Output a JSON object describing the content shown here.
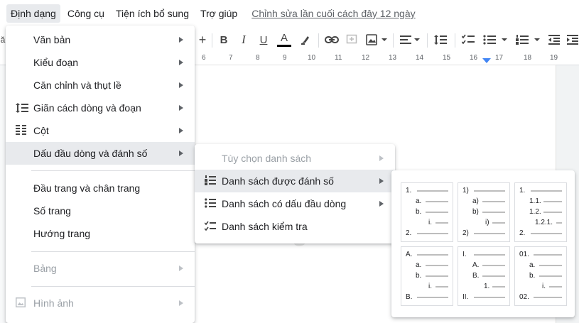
{
  "menubar": {
    "items": [
      "Định dạng",
      "Công cụ",
      "Tiện ích bổ sung",
      "Trợ giúp"
    ],
    "last_edit": "Chỉnh sửa lần cuối cách đây 12 ngày"
  },
  "toolbar": {
    "plus": "+",
    "bold": "B",
    "italic": "I",
    "underline": "U",
    "text_color": "A",
    "text_color_value": "#000000",
    "left_fragment": "ă"
  },
  "ruler": {
    "numbers": [
      "6",
      "7",
      "8",
      "9",
      "10",
      "11",
      "12",
      "13",
      "14",
      "15",
      "16",
      "17",
      "18",
      "19"
    ]
  },
  "format_menu": {
    "items": [
      {
        "label": "Văn bản",
        "submenu": true
      },
      {
        "label": "Kiểu đoạn",
        "submenu": true
      },
      {
        "label": "Căn chỉnh và thụt lề",
        "submenu": true
      },
      {
        "label": "Giãn cách dòng và đoạn",
        "submenu": true,
        "icon": "line-spacing-icon"
      },
      {
        "label": "Cột",
        "submenu": true,
        "icon": "columns-icon"
      },
      {
        "label": "Dấu đầu dòng và đánh số",
        "submenu": true,
        "active": true
      },
      {
        "label": "Đầu trang và chân trang"
      },
      {
        "label": "Số trang"
      },
      {
        "label": "Hướng trang"
      },
      {
        "label": "Bảng",
        "submenu": true,
        "disabled": true
      },
      {
        "label": "Hình ảnh",
        "submenu": true,
        "disabled": true,
        "icon": "image-icon"
      }
    ]
  },
  "bullets_menu": {
    "items": [
      {
        "label": "Tùy chọn danh sách",
        "submenu": true,
        "disabled": true
      },
      {
        "label": "Danh sách được đánh số",
        "submenu": true,
        "active": true
      },
      {
        "label": "Danh sách có dấu đầu dòng",
        "submenu": true
      },
      {
        "label": "Danh sách kiểm tra"
      }
    ]
  },
  "numbered_presets": [
    {
      "markers": [
        "1.",
        "a.",
        "b.",
        "i.",
        "2."
      ]
    },
    {
      "markers": [
        "1)",
        "a)",
        "b)",
        "i)",
        "2)"
      ]
    },
    {
      "markers": [
        "1.",
        "1.1.",
        "1.2.",
        "1.2.1.",
        "2."
      ]
    },
    {
      "markers": [
        "A.",
        "a.",
        "b.",
        "i.",
        "B."
      ]
    },
    {
      "markers": [
        "I.",
        "A.",
        "B.",
        "1.",
        "II."
      ]
    },
    {
      "markers": [
        "01.",
        "a.",
        "b.",
        "i.",
        "02."
      ]
    }
  ],
  "watermark": "uantrimang"
}
